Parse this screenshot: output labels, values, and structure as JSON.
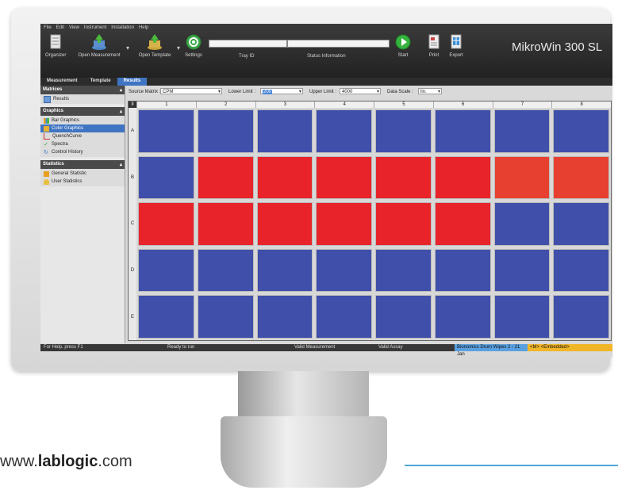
{
  "menu": [
    "File",
    "Edit",
    "View",
    "Instrument",
    "Installation",
    "Help"
  ],
  "toolbar": {
    "organizer": "Organizer",
    "open_measurement": "Open Measurement",
    "open_template": "Open Template",
    "settings": "Settings",
    "tray_id": "Tray ID",
    "status_information": "Status Information",
    "start": "Start",
    "print": "Print",
    "export": "Export"
  },
  "app_title": "MikroWin 300 SL",
  "tabs": [
    "Measurement",
    "Template",
    "Results"
  ],
  "active_tab": "Results",
  "sidebar": {
    "matrices": {
      "title": "Matrices",
      "items": [
        "Results"
      ]
    },
    "graphics": {
      "title": "Graphics",
      "items": [
        "Bar Graphics",
        "Color Graphics",
        "QuenchCurve",
        "Spectra",
        "Control History"
      ],
      "selected": "Color Graphics"
    },
    "statistics": {
      "title": "Statistics",
      "items": [
        "General Statistic",
        "User Statistics"
      ]
    }
  },
  "controls": {
    "source_matrix_label": "Source Matrix :",
    "source_matrix_value": "CPM",
    "lower_limit_label": "Lower Limit :",
    "lower_limit_value": "200",
    "upper_limit_label": "Upper Limit :",
    "upper_limit_value": "4000",
    "data_scale_label": "Data Scale :",
    "data_scale_value": "lin."
  },
  "grid": {
    "corner": "II",
    "columns": [
      "1",
      "2",
      "3",
      "4",
      "5",
      "6",
      "7",
      "8"
    ],
    "rows": [
      "A",
      "B",
      "C",
      "D",
      "E"
    ],
    "colors": {
      "low": "#3f4faa",
      "high": "#e8232a",
      "mid": "#e84030"
    },
    "cells": [
      [
        "low",
        "low",
        "low",
        "low",
        "low",
        "low",
        "low",
        "low"
      ],
      [
        "low",
        "high",
        "high",
        "high",
        "high",
        "high",
        "mid",
        "mid"
      ],
      [
        "high",
        "high",
        "high",
        "high",
        "high",
        "high",
        "low",
        "low"
      ],
      [
        "low",
        "low",
        "low",
        "low",
        "low",
        "low",
        "low",
        "low"
      ],
      [
        "low",
        "low",
        "low",
        "low",
        "low",
        "low",
        "low",
        "low"
      ]
    ]
  },
  "status": {
    "help": "For Help, press F1",
    "ready": "Ready to run",
    "valid_measurement": "Valid Measurement",
    "valid_assay": "Valid Assay",
    "assay_name": "Bionomics Drum Wipes 2 - 21 Jan",
    "mode": "<M> <Embedded>"
  },
  "website": {
    "prefix": "www.",
    "brand": "lablogic",
    "suffix": ".com"
  }
}
